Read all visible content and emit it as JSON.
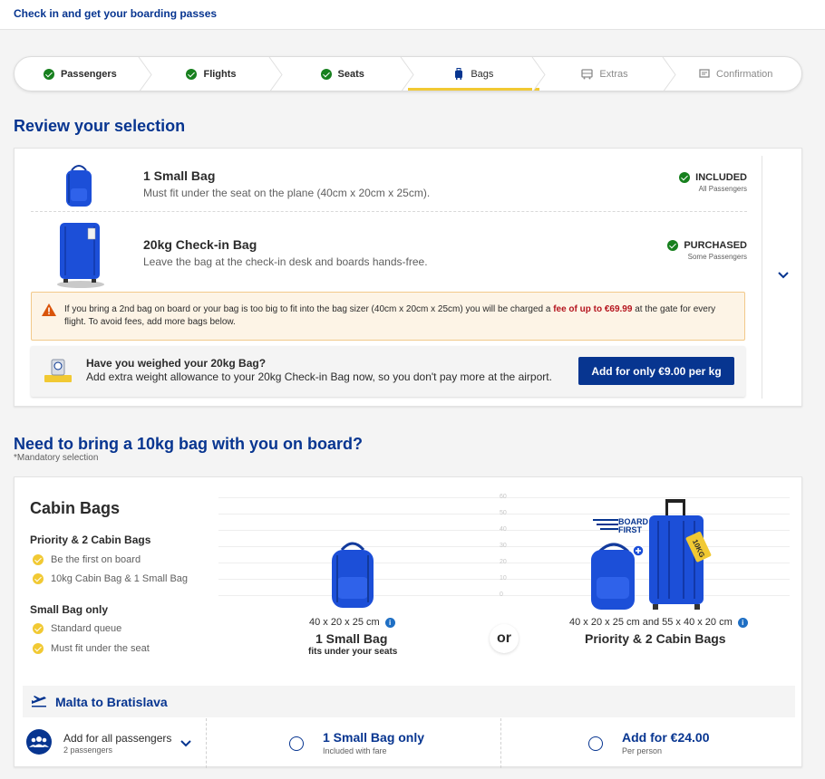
{
  "header": {
    "title": "Check in and get your boarding passes"
  },
  "steps": [
    {
      "label": "Passengers",
      "state": "done",
      "icon": "check-icon"
    },
    {
      "label": "Flights",
      "state": "done",
      "icon": "check-icon"
    },
    {
      "label": "Seats",
      "state": "done",
      "icon": "check-icon"
    },
    {
      "label": "Bags",
      "state": "active",
      "icon": "luggage-icon"
    },
    {
      "label": "Extras",
      "state": "inactive",
      "icon": "bus-icon"
    },
    {
      "label": "Confirmation",
      "state": "inactive",
      "icon": "document-icon"
    }
  ],
  "review": {
    "title": "Review your selection",
    "small_bag": {
      "name": "1 Small Bag",
      "desc": "Must fit under the seat on the plane (40cm x 20cm x 25cm).",
      "status": "INCLUDED",
      "status_sub": "All Passengers"
    },
    "checkin_bag": {
      "name": "20kg Check-in Bag",
      "desc": "Leave the bag at the check-in desk and boards hands-free.",
      "status": "PURCHASED",
      "status_sub": "Some Passengers"
    },
    "warning": {
      "before": "If you bring a 2nd bag on board or your bag is too big to fit into the bag sizer (40cm x 20cm x 25cm) you will be charged a ",
      "fee": "fee of up to €69.99",
      "after": " at the gate for every flight. To avoid fees, add more bags below."
    },
    "weigh": {
      "question": "Have you weighed your 20kg Bag?",
      "text": "Add extra weight allowance to your 20kg Check-in Bag now, so you don't pay more at the airport.",
      "button": "Add for only €9.00 per kg"
    }
  },
  "cabin": {
    "heading": "Need to bring a 10kg bag with you on board?",
    "mandatory": "*Mandatory selection",
    "title": "Cabin Bags",
    "priority": {
      "title": "Priority & 2 Cabin Bags",
      "bullets": [
        "Be the first on board",
        "10kg Cabin Bag & 1 Small Bag"
      ]
    },
    "small": {
      "title": "Small Bag only",
      "bullets": [
        "Standard queue",
        "Must fit under the seat"
      ]
    },
    "ticks": [
      "60",
      "50",
      "40",
      "30",
      "20",
      "10",
      "0"
    ],
    "left_option": {
      "dims": "40 x 20 x 25 cm",
      "name": "1 Small Bag",
      "note": "fits under your seats"
    },
    "or": "or",
    "right_option": {
      "dims": "40 x 20 x 25 cm and 55 x 40 x 20 cm",
      "name": "Priority & 2 Cabin Bags",
      "board_first": [
        "BOARD",
        "FIRST"
      ],
      "tag": "10KG"
    },
    "route": "Malta to Bratislava",
    "selection": {
      "all": "Add for all passengers",
      "all_sub": "2 passengers",
      "opt1": "1 Small Bag only",
      "opt1_sub": "Included with fare",
      "opt2": "Add for €24.00",
      "opt2_sub": "Per person"
    }
  },
  "colors": {
    "brand": "#073590",
    "accent": "#f1c933",
    "success": "#17801e",
    "warning_text": "#b5151f",
    "bag_blue": "#1c4fd8"
  }
}
